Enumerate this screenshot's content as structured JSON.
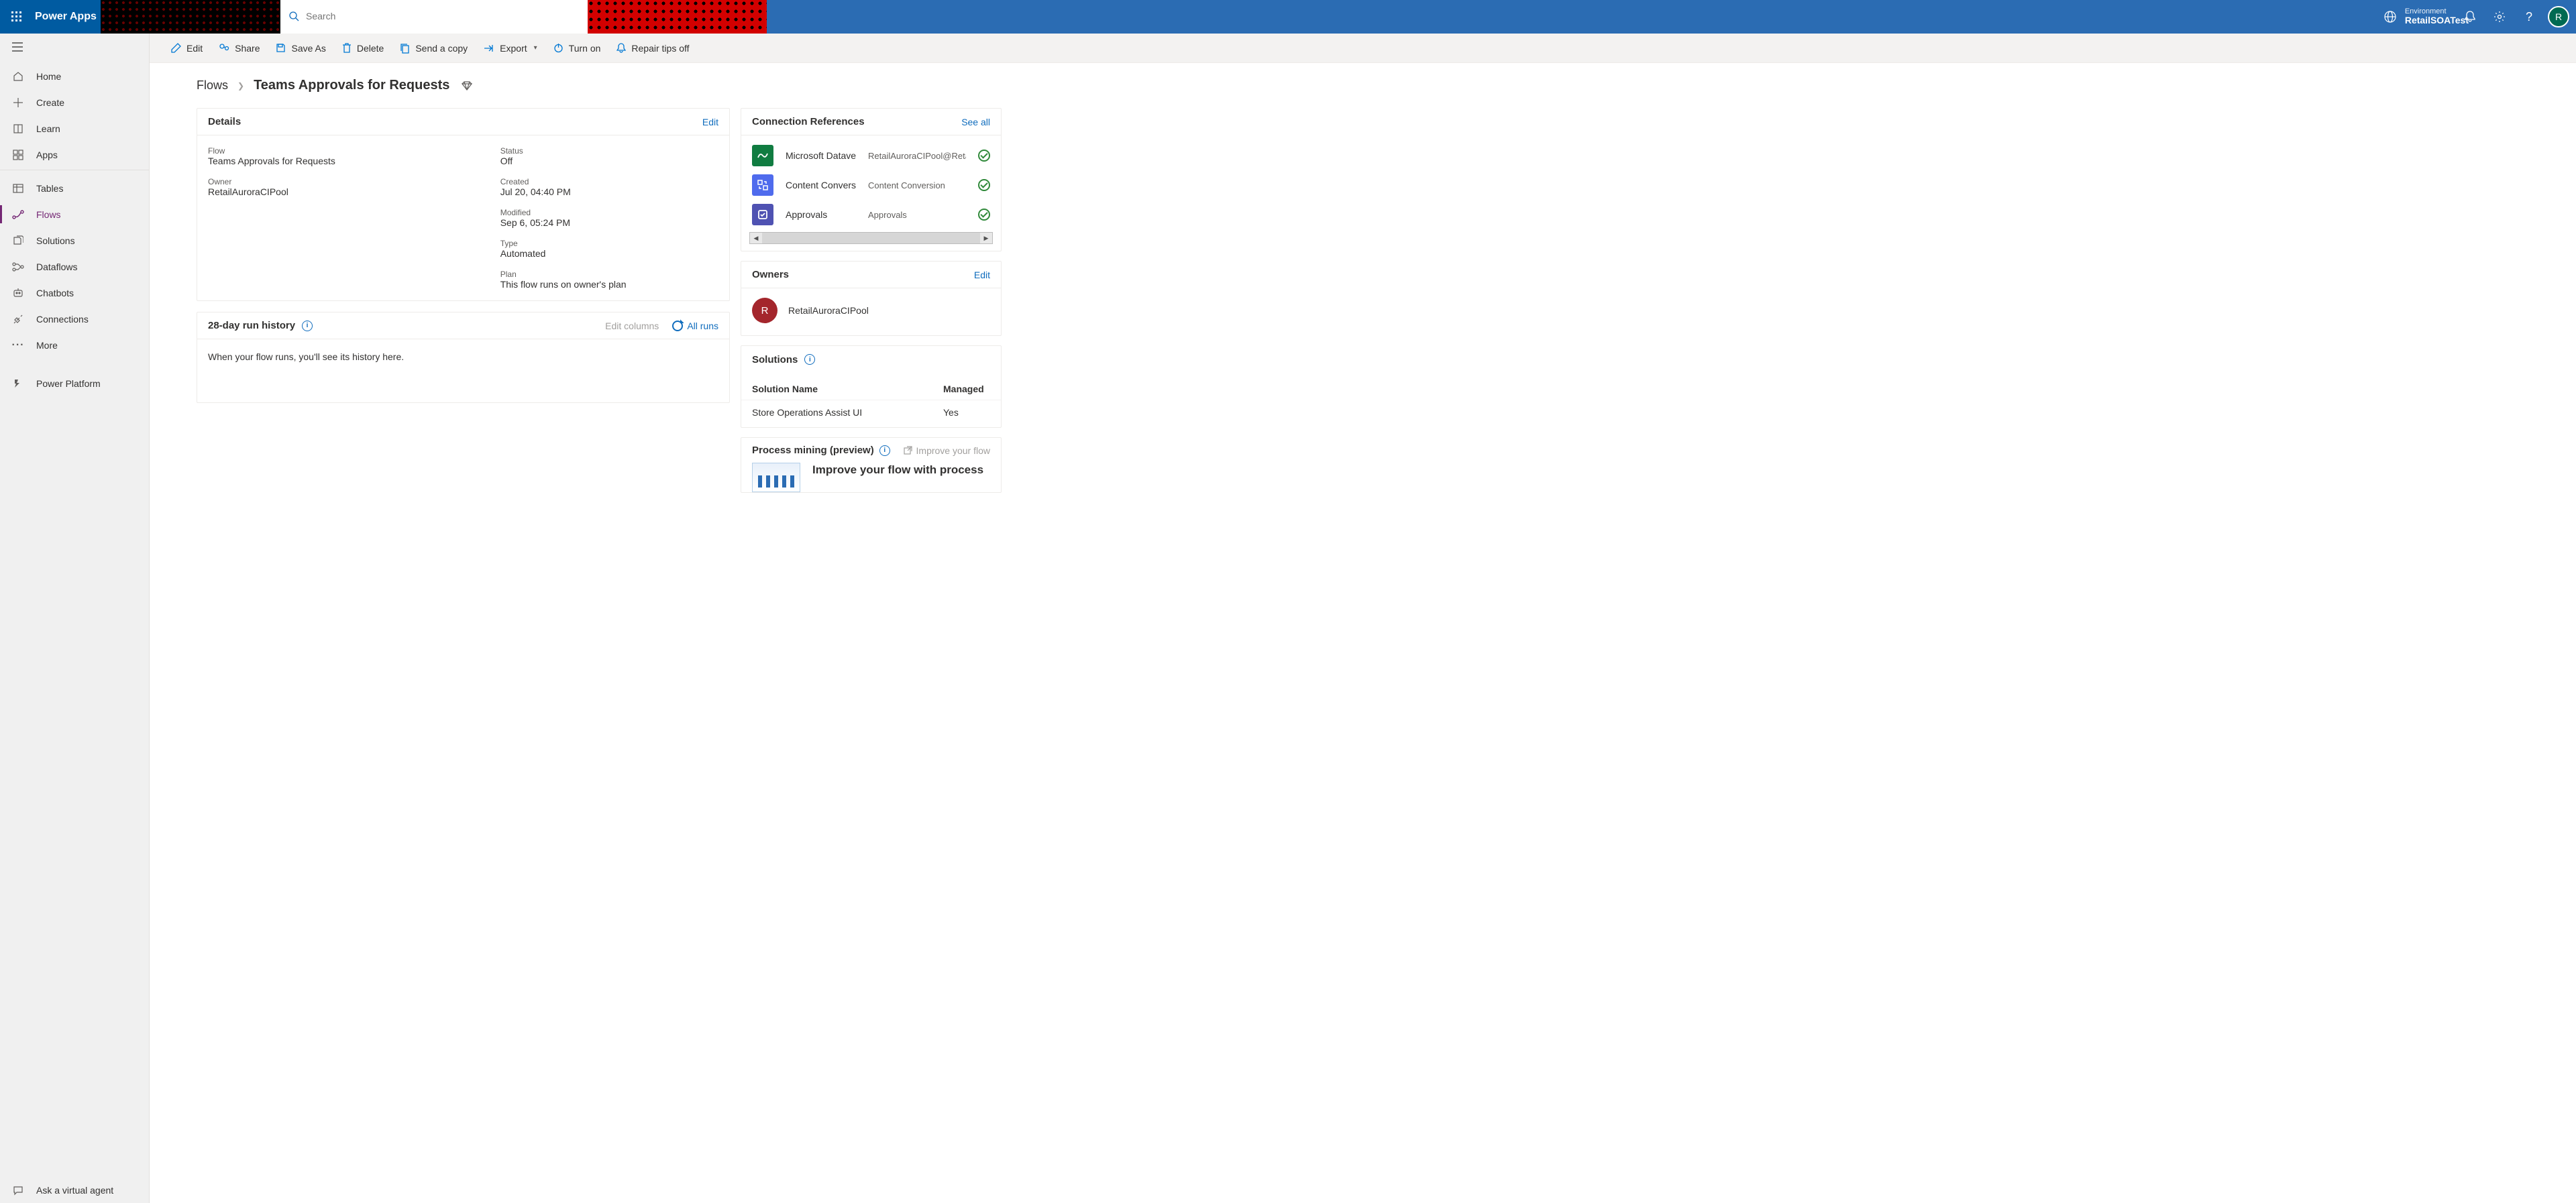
{
  "header": {
    "brand": "Power Apps",
    "search_placeholder": "Search",
    "environment_label": "Environment",
    "environment_name": "RetailSOATest",
    "avatar_initial": "R"
  },
  "leftnav": {
    "home": "Home",
    "create": "Create",
    "learn": "Learn",
    "apps": "Apps",
    "tables": "Tables",
    "flows": "Flows",
    "solutions": "Solutions",
    "dataflows": "Dataflows",
    "chatbots": "Chatbots",
    "connections": "Connections",
    "more": "More",
    "power_platform": "Power Platform",
    "ask_agent": "Ask a virtual agent"
  },
  "cmdbar": {
    "edit": "Edit",
    "share": "Share",
    "save_as": "Save As",
    "delete": "Delete",
    "send_copy": "Send a copy",
    "export": "Export",
    "turn_on": "Turn on",
    "repair_tips_off": "Repair tips off"
  },
  "breadcrumb": {
    "root": "Flows",
    "title": "Teams Approvals for Requests"
  },
  "details": {
    "title": "Details",
    "edit": "Edit",
    "flow_label": "Flow",
    "flow_value": "Teams Approvals for Requests",
    "owner_label": "Owner",
    "owner_value": "RetailAuroraCIPool",
    "status_label": "Status",
    "status_value": "Off",
    "created_label": "Created",
    "created_value": "Jul 20, 04:40 PM",
    "modified_label": "Modified",
    "modified_value": "Sep 6, 05:24 PM",
    "type_label": "Type",
    "type_value": "Automated",
    "plan_label": "Plan",
    "plan_value": "This flow runs on owner's plan"
  },
  "history": {
    "title": "28-day run history",
    "edit_columns": "Edit columns",
    "all_runs": "All runs",
    "empty": "When your flow runs, you'll see its history here."
  },
  "connections": {
    "title": "Connection References",
    "see_all": "See all",
    "items": [
      {
        "name": "Microsoft Dataverse",
        "value": "RetailAuroraCIPool@RetailCPO",
        "color": "green"
      },
      {
        "name": "Content Conversion",
        "value": "Content Conversion",
        "color": "blue"
      },
      {
        "name": "Approvals",
        "value": "Approvals",
        "color": "purple"
      }
    ]
  },
  "owners": {
    "title": "Owners",
    "edit": "Edit",
    "initial": "R",
    "name": "RetailAuroraCIPool"
  },
  "solutions": {
    "title": "Solutions",
    "col_name": "Solution Name",
    "col_managed": "Managed",
    "row_name": "Store Operations Assist UI",
    "row_managed": "Yes"
  },
  "process_mining": {
    "title": "Process mining (preview)",
    "improve_link": "Improve your flow",
    "headline": "Improve your flow with process"
  }
}
